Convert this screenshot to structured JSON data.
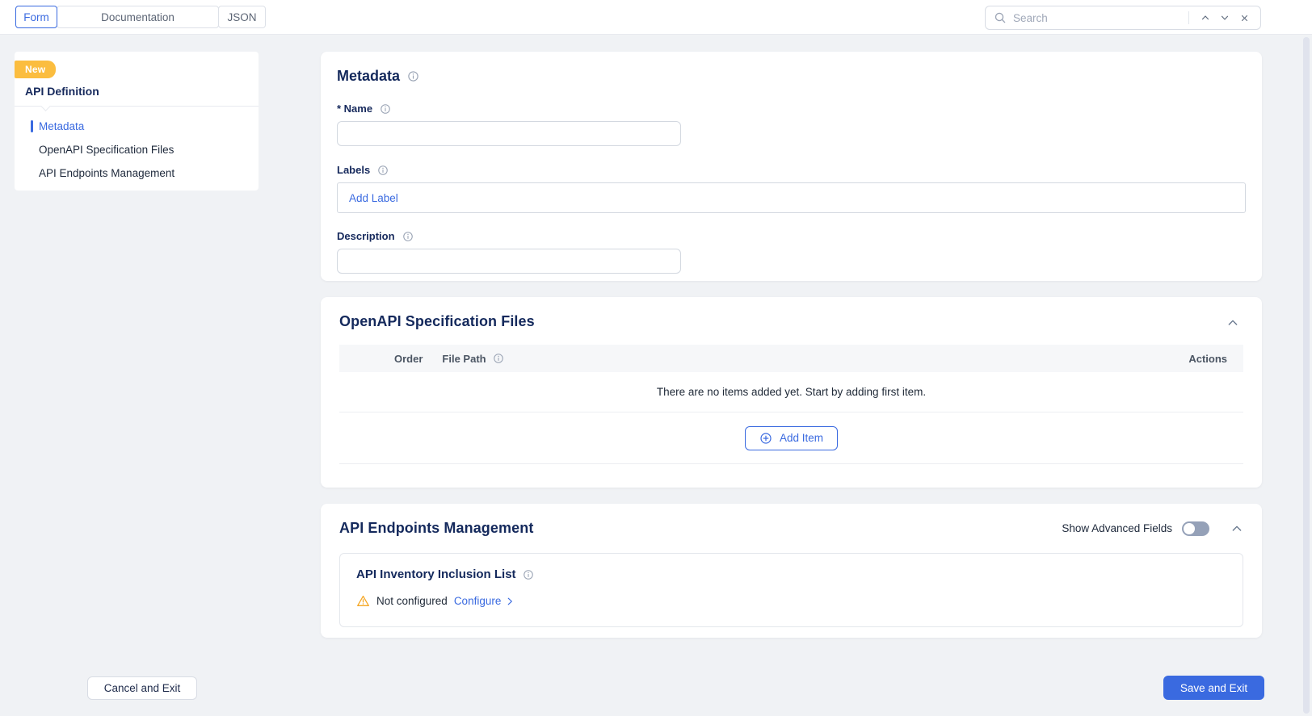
{
  "topbar": {
    "tabs": [
      {
        "label": "Form",
        "active": true
      },
      {
        "label": "Documentation",
        "active": false
      },
      {
        "label": "JSON",
        "active": false
      }
    ],
    "search": {
      "placeholder": "Search",
      "value": ""
    }
  },
  "sidebar": {
    "badge": "New",
    "title": "API Definition",
    "items": [
      {
        "label": "Metadata",
        "active": true
      },
      {
        "label": "OpenAPI Specification Files",
        "active": false
      },
      {
        "label": "API Endpoints Management",
        "active": false
      }
    ]
  },
  "metadata_section": {
    "title": "Metadata",
    "fields": {
      "name_label": "* Name",
      "name_value": "",
      "labels_label": "Labels",
      "add_label": "Add Label",
      "description_label": "Description",
      "description_value": ""
    }
  },
  "spec_files_section": {
    "title": "OpenAPI Specification Files",
    "collapsed": false,
    "table": {
      "columns": [
        "Order",
        "File Path",
        "Actions"
      ],
      "rows": [],
      "empty_message": "There are no items added yet. Start by adding first item.",
      "add_item_label": "Add Item"
    }
  },
  "endpoints_section": {
    "title": "API Endpoints Management",
    "show_advanced_label": "Show Advanced Fields",
    "show_advanced_state": "off",
    "collapsed": false,
    "inclusion": {
      "title": "API Inventory Inclusion List",
      "status": "Not configured",
      "action": "Configure"
    }
  },
  "footer": {
    "cancel_label": "Cancel and Exit",
    "save_label": "Save and Exit"
  },
  "icons": {
    "search": "magnifier",
    "find_prev": "chevron-up",
    "find_next": "chevron-down",
    "close": "x",
    "info": "circled-i",
    "collapse": "chevron-up",
    "add": "plus-in-circle",
    "warning": "exclamation-triangle",
    "configure_arrow": "chevron-right"
  },
  "colors": {
    "accent_blue": "#3a6ae0",
    "badge_orange": "#fbbd3f",
    "warning_amber": "#f5a623",
    "heading_navy": "#14295c",
    "background": "#f0f2f5"
  }
}
